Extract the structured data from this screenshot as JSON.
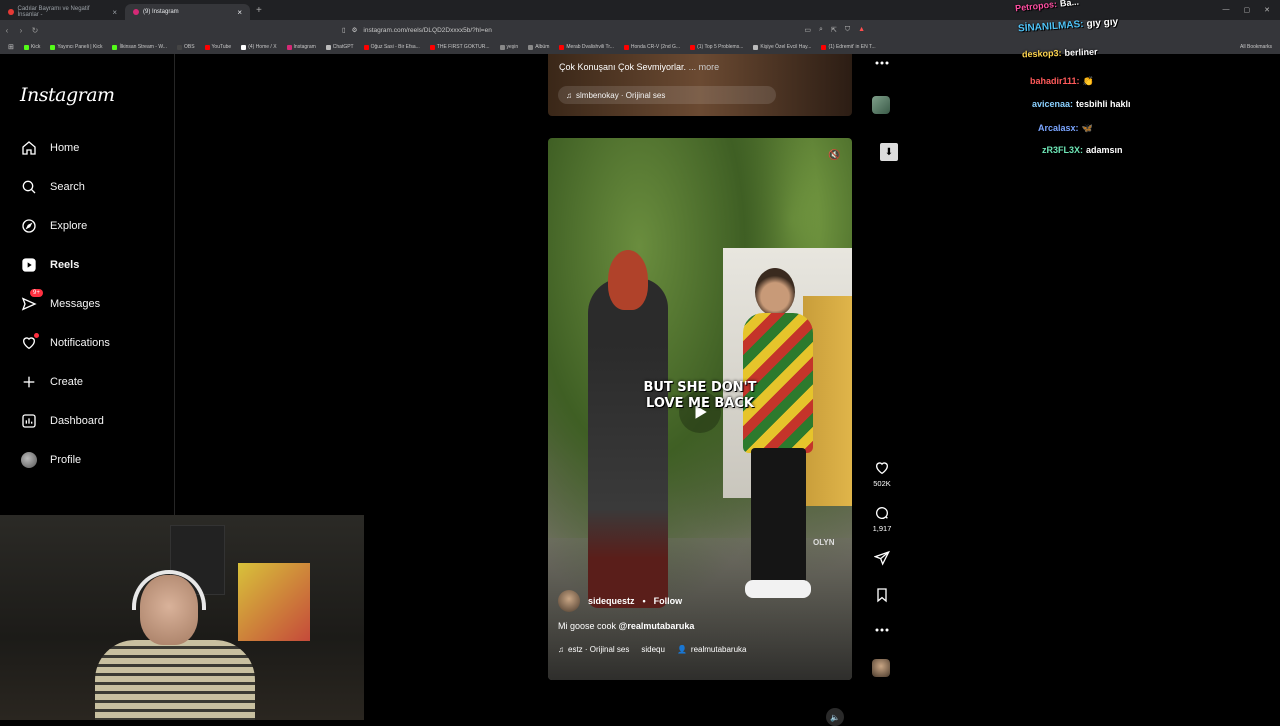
{
  "browser": {
    "tabs": [
      {
        "title": "Cadılar Bayramı ve Negatif İnsanlar -",
        "active": false,
        "color": "#e53935"
      },
      {
        "title": "(9) Instagram",
        "active": true,
        "color": "#d62976"
      }
    ],
    "url": "instagram.com/reels/DLQD2Dxxxx5b/?hl=en",
    "bookmarks": [
      {
        "label": "Kick",
        "color": "#53fc18"
      },
      {
        "label": "Yayıncı Paneli | Kick",
        "color": "#53fc18"
      },
      {
        "label": "İlkinsan Stream - W...",
        "color": "#53fc18"
      },
      {
        "label": "OBS",
        "color": "#444444"
      },
      {
        "label": "YouTube",
        "color": "#ff0000"
      },
      {
        "label": "(4) Home / X",
        "color": "#ffffff"
      },
      {
        "label": "Instagram",
        "color": "#d62976"
      },
      {
        "label": "ChatGPT",
        "color": "#bbbbbb"
      },
      {
        "label": "Oğuz Sasi - Bir Efsa...",
        "color": "#ff0000"
      },
      {
        "label": "THE FIRST GOKTUR...",
        "color": "#ff0000"
      },
      {
        "label": "yeşin",
        "color": "#888888"
      },
      {
        "label": "Albüm",
        "color": "#888888"
      },
      {
        "label": "Merab Dvalishvili Tr...",
        "color": "#ff0000"
      },
      {
        "label": "Honda CR-V (2nd G...",
        "color": "#ff0000"
      },
      {
        "label": "(1) Top 5 Problems...",
        "color": "#ff0000"
      },
      {
        "label": "Kişiye Özel Evcil Hay...",
        "color": "#bbbbbb"
      },
      {
        "label": "(1) Edremit' in EN T...",
        "color": "#ff0000"
      }
    ],
    "all_bookmarks": "All Bookmarks"
  },
  "sidebar": {
    "logo": "Instagram",
    "items": [
      {
        "label": "Home",
        "icon": "home-icon"
      },
      {
        "label": "Search",
        "icon": "search-icon"
      },
      {
        "label": "Explore",
        "icon": "compass-icon"
      },
      {
        "label": "Reels",
        "icon": "reels-icon",
        "active": true
      },
      {
        "label": "Messages",
        "icon": "messenger-icon",
        "badge": "9+"
      },
      {
        "label": "Notifications",
        "icon": "heart-icon",
        "dot": true
      },
      {
        "label": "Create",
        "icon": "plus-icon"
      },
      {
        "label": "Dashboard",
        "icon": "dashboard-icon"
      },
      {
        "label": "Profile",
        "icon": "avatar"
      }
    ]
  },
  "prev_post": {
    "caption": "Çok Konuşanı Çok Sevmiyorlar.",
    "more": "... more",
    "audio": "slmbenokay · Orijinal ses"
  },
  "reel": {
    "subtitle_line1": "BUT SHE DON'T",
    "subtitle_line2": "LOVE ME BACK",
    "author": "sidequestz",
    "follow": "Follow",
    "separator": "•",
    "caption_text": "Mi goose cook",
    "caption_mention": "@realmutabaruka",
    "audio": "estz · Orijinal ses",
    "audio_extra": "sidequ",
    "tagged_user": "realmutabaruka",
    "watermark": "OLYN"
  },
  "actions": {
    "likes": "502K",
    "comments": "1,917"
  },
  "chat": [
    {
      "user": "Petropos:",
      "msg": "Ba...",
      "color": "#ff4fa3"
    },
    {
      "user": "SİNANILMAS:",
      "msg": "gıy gıy",
      "color": "#4fc3f7"
    },
    {
      "user": "deskop3:",
      "msg": "berliner",
      "color": "#ffd54f"
    },
    {
      "user": "bahadir111:",
      "msg": "👏",
      "color": "#ff5a5a"
    },
    {
      "user": "avicenaa:",
      "msg": "tesbihli haklı",
      "color": "#8ad0ff"
    },
    {
      "user": "Arcalasx:",
      "msg": "🦋",
      "color": "#7aa5ff"
    },
    {
      "user": "zR3FL3X:",
      "msg": "adamsın",
      "color": "#6ee7b7"
    }
  ]
}
